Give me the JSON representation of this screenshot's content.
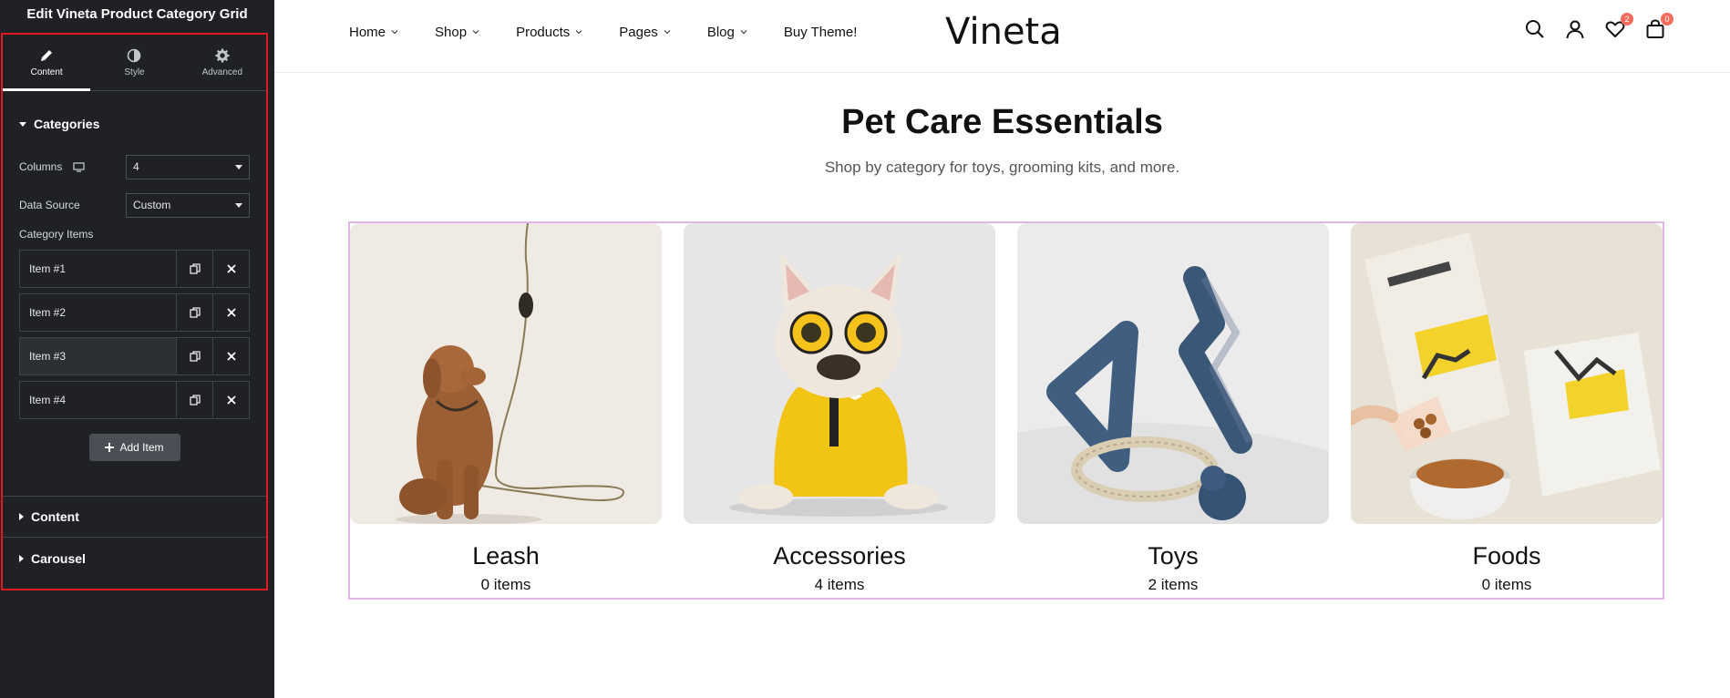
{
  "panel": {
    "title": "Edit Vineta Product Category Grid",
    "tabs": [
      {
        "label": "Content",
        "icon": "pencil-icon",
        "active": true
      },
      {
        "label": "Style",
        "icon": "contrast-icon",
        "active": false
      },
      {
        "label": "Advanced",
        "icon": "gear-icon",
        "active": false
      }
    ],
    "categories_section": "Categories",
    "columns_label": "Columns",
    "columns_value": "4",
    "data_source_label": "Data Source",
    "data_source_value": "Custom",
    "category_items_label": "Category Items",
    "items": [
      {
        "label": "Item #1"
      },
      {
        "label": "Item #2"
      },
      {
        "label": "Item #3"
      },
      {
        "label": "Item #4"
      }
    ],
    "add_item_label": "Add Item",
    "content_section": "Content",
    "carousel_section": "Carousel",
    "colors": {
      "bg": "#1f2124",
      "highlight": "#e11b22"
    }
  },
  "site": {
    "nav": [
      {
        "label": "Home"
      },
      {
        "label": "Shop"
      },
      {
        "label": "Products"
      },
      {
        "label": "Pages"
      },
      {
        "label": "Blog"
      },
      {
        "label": "Buy Theme!"
      }
    ],
    "logo": "Vineta",
    "wishlist_count": "2",
    "cart_count": "0",
    "heading": "Pet Care Essentials",
    "subheading": "Shop by category for toys, grooming kits, and more.",
    "categories": [
      {
        "name": "Leash",
        "count": "0 items"
      },
      {
        "name": "Accessories",
        "count": "4 items"
      },
      {
        "name": "Toys",
        "count": "2 items"
      },
      {
        "name": "Foods",
        "count": "0 items"
      }
    ],
    "colors": {
      "selection_outline": "#e3b4ea",
      "badge": "#f26b5b"
    }
  }
}
